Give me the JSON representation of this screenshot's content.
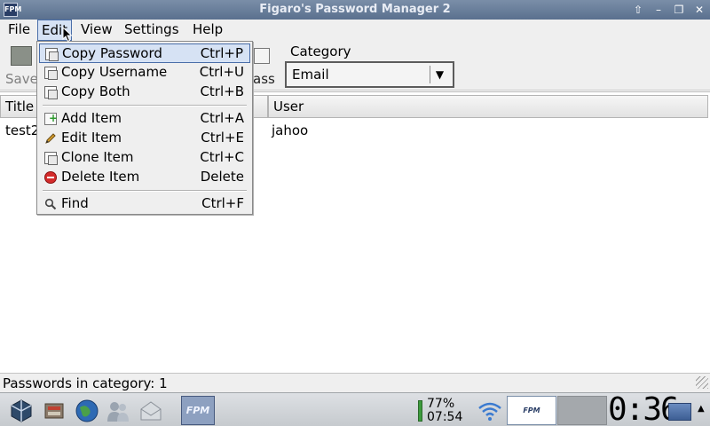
{
  "window": {
    "title": "Figaro's Password Manager 2",
    "icon_text": "FPM",
    "buttons": [
      "up-icon",
      "minimize-icon",
      "restore-icon",
      "close-icon"
    ]
  },
  "menubar": {
    "items": [
      {
        "label": "File"
      },
      {
        "label": "Edit",
        "active": true
      },
      {
        "label": "View"
      },
      {
        "label": "Settings"
      },
      {
        "label": "Help"
      }
    ]
  },
  "toolbar": {
    "save_label": "Save",
    "copy_pass_label": "ass",
    "category_label": "Category",
    "category_value": "Email"
  },
  "table": {
    "headers": [
      "Title",
      "User"
    ],
    "rows": [
      {
        "title": "test2",
        "user": "jahoo"
      }
    ]
  },
  "edit_menu": {
    "items": [
      {
        "label": "Copy Password",
        "accel": "Ctrl+P",
        "icon": "copy-icon",
        "highlighted": true
      },
      {
        "label": "Copy Username",
        "accel": "Ctrl+U",
        "icon": "copy-icon"
      },
      {
        "label": "Copy Both",
        "accel": "Ctrl+B",
        "icon": "copy-icon"
      },
      {
        "label": "Add Item",
        "accel": "Ctrl+A",
        "icon": "add-icon"
      },
      {
        "label": "Edit Item",
        "accel": "Ctrl+E",
        "icon": "pencil-icon"
      },
      {
        "label": "Clone Item",
        "accel": "Ctrl+C",
        "icon": "copy-icon"
      },
      {
        "label": "Delete Item",
        "accel": "Delete",
        "icon": "delete-icon"
      },
      {
        "label": "Find",
        "accel": "Ctrl+F",
        "icon": "search-icon"
      }
    ]
  },
  "statusbar": {
    "text": "Passwords in category: 1"
  },
  "taskbar": {
    "fpm_label": "FPM",
    "battery_percent": "77%",
    "battery_time": "07:54",
    "clock": "0:36",
    "pager_label": "FPM",
    "icons": [
      "package-icon",
      "gear-icon",
      "globe-icon",
      "users-icon",
      "mail-icon"
    ]
  },
  "colors": {
    "titlebar": "#5a708e",
    "menu_highlight": "#d6e2f4",
    "highlight_border": "#4a6ea9",
    "delete_red": "#d42b2b"
  }
}
